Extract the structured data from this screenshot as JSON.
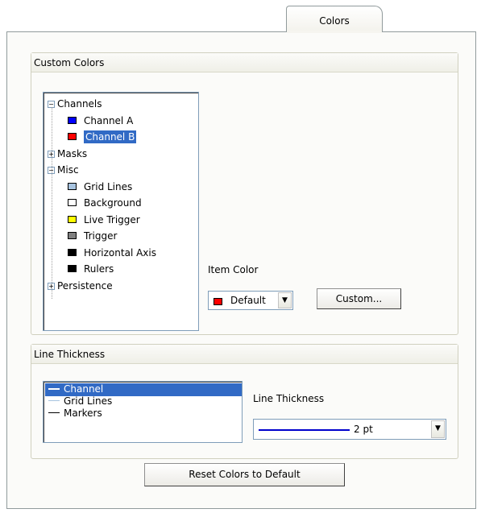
{
  "tab": {
    "label": "Colors"
  },
  "custom_colors": {
    "title": "Custom Colors",
    "tree": [
      {
        "label": "Channels",
        "level": 0,
        "expander": "minus"
      },
      {
        "label": "Channel A",
        "level": 1,
        "color": "#0000ff"
      },
      {
        "label": "Channel B",
        "level": 1,
        "color": "#ff0000",
        "selected": true
      },
      {
        "label": "Masks",
        "level": 0,
        "expander": "plus"
      },
      {
        "label": "Misc",
        "level": 0,
        "expander": "minus"
      },
      {
        "label": "Grid Lines",
        "level": 1,
        "color": "#a8c4e0"
      },
      {
        "label": "Background",
        "level": 1,
        "color": "#ffffff"
      },
      {
        "label": "Live Trigger",
        "level": 1,
        "color": "#ffff00"
      },
      {
        "label": "Trigger",
        "level": 1,
        "color": "#808080"
      },
      {
        "label": "Horizontal Axis",
        "level": 1,
        "color": "#000000"
      },
      {
        "label": "Rulers",
        "level": 1,
        "color": "#000000"
      },
      {
        "label": "Persistence",
        "level": 0,
        "expander": "plus"
      }
    ],
    "item_color_label": "Item Color",
    "item_color_value": "Default",
    "item_color_swatch": "#ff0000",
    "custom_button": "Custom..."
  },
  "line_thickness": {
    "title": "Line Thickness",
    "items": [
      {
        "label": "Channel",
        "color": "#0000ff",
        "selected": true
      },
      {
        "label": "Grid Lines",
        "color": "#a8c4e0"
      },
      {
        "label": "Markers",
        "color": "#000000"
      }
    ],
    "thickness_label": "Line Thickness",
    "thickness_value": "2 pt",
    "thickness_color": "#0000cc"
  },
  "reset_button": "Reset Colors to Default"
}
